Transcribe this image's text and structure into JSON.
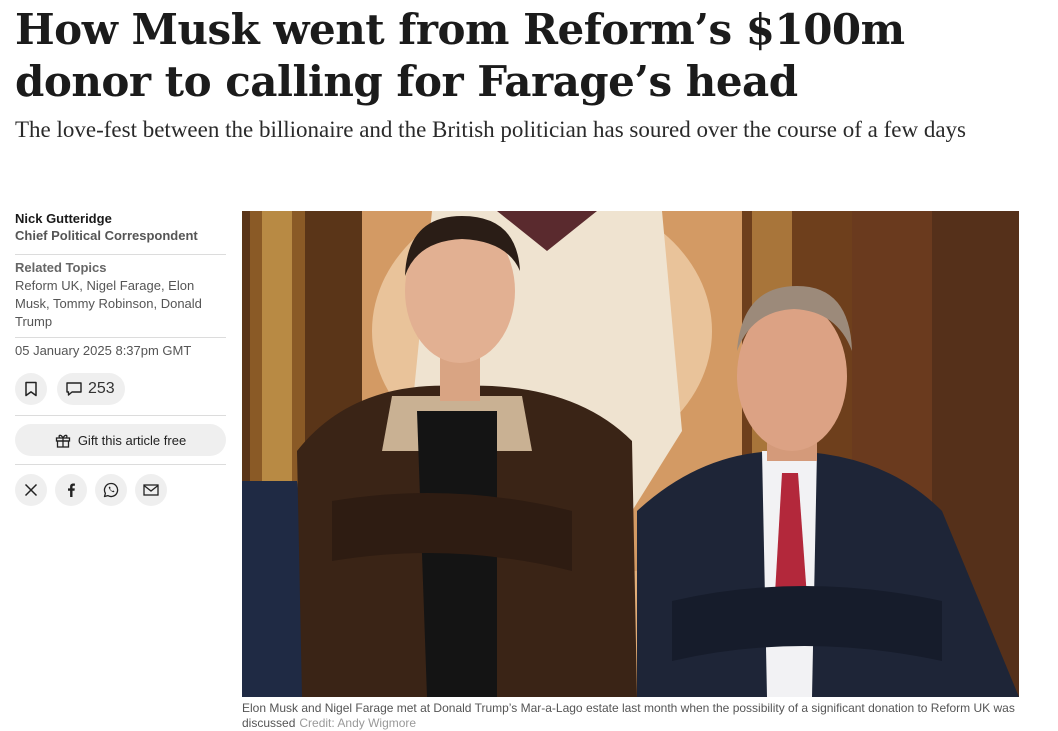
{
  "article": {
    "headline": "How Musk went from Reform’s $100m donor to calling for Farage’s head",
    "standfirst": "The love-fest between the billionaire and the British politician has soured over the course of a few days",
    "author": {
      "name": "Nick Gutteridge",
      "role": "Chief Political Correspondent"
    },
    "related_topics": {
      "title": "Related Topics",
      "items": "Reform UK, Nigel Farage, Elon Musk, Tommy Robinson, Donald Trump"
    },
    "date": "05 January 2025 8:37pm GMT",
    "comments_count": "253",
    "gift_label": "Gift this article free",
    "share": [
      "x-icon",
      "facebook-icon",
      "whatsapp-icon",
      "email-icon"
    ],
    "image": {
      "caption": "Elon Musk and Nigel Farage met at Donald Trump’s Mar-a-Lago estate last month when the possibility of a significant donation to Reform UK was discussed",
      "credit": "Credit: Andy Wigmore"
    }
  }
}
